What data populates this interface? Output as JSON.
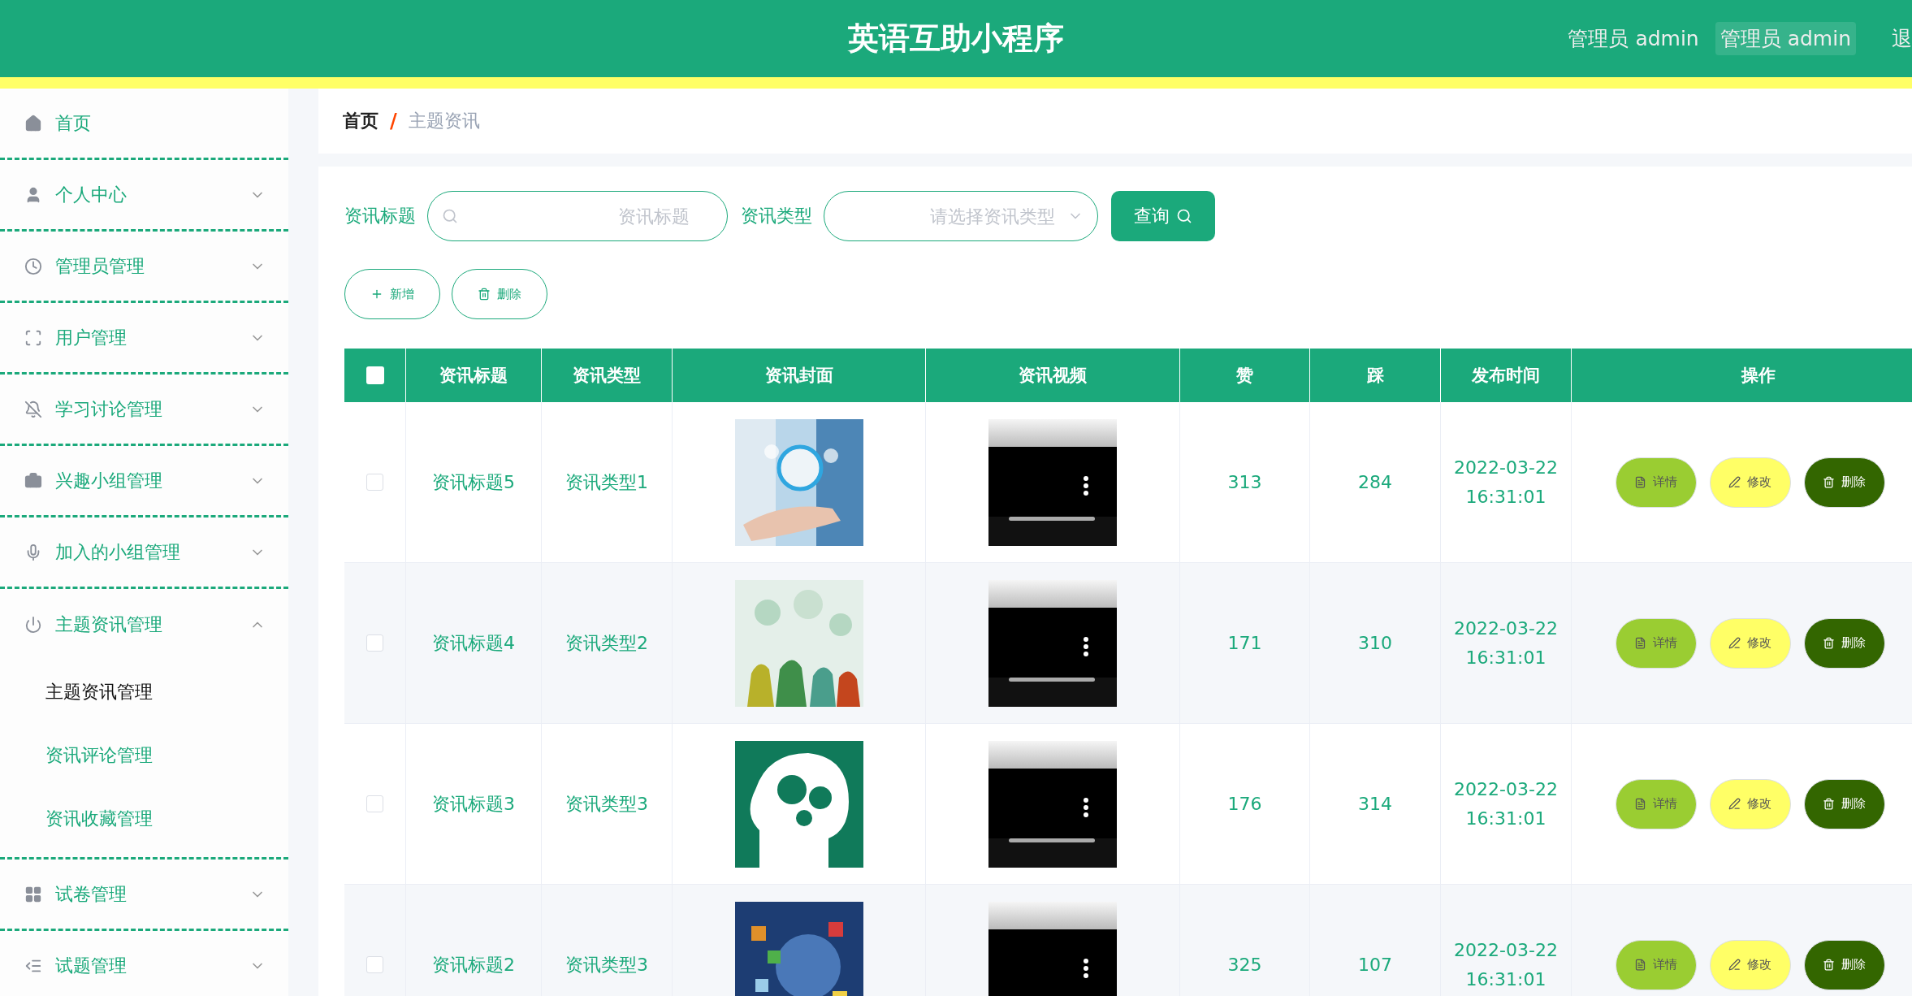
{
  "header": {
    "title": "英语互助小程序",
    "users": [
      {
        "label": "管理员 admin",
        "selected": false
      },
      {
        "label": "管理员 admin",
        "selected": true
      }
    ],
    "logout": "退"
  },
  "sidebar": {
    "items": [
      {
        "label": "首页",
        "kind": "link"
      },
      {
        "label": "个人中心",
        "kind": "menu",
        "expanded": false
      },
      {
        "label": "管理员管理",
        "kind": "menu",
        "expanded": false
      },
      {
        "label": "用户管理",
        "kind": "menu",
        "expanded": false
      },
      {
        "label": "学习讨论管理",
        "kind": "menu",
        "expanded": false
      },
      {
        "label": "兴趣小组管理",
        "kind": "menu",
        "expanded": false
      },
      {
        "label": "加入的小组管理",
        "kind": "menu",
        "expanded": false
      },
      {
        "label": "主题资讯管理",
        "kind": "menu",
        "expanded": true,
        "children": [
          {
            "label": "主题资讯管理",
            "selected": true
          },
          {
            "label": "资讯评论管理",
            "selected": false
          },
          {
            "label": "资讯收藏管理",
            "selected": false
          }
        ]
      },
      {
        "label": "试卷管理",
        "kind": "menu",
        "expanded": false
      },
      {
        "label": "试题管理",
        "kind": "menu",
        "expanded": false
      }
    ]
  },
  "breadcrumb": {
    "items": [
      "首页",
      "主题资讯"
    ],
    "separator": "/"
  },
  "search": {
    "fields": [
      {
        "label": "资讯标题",
        "placeholder": "资讯标题",
        "kind": "input"
      },
      {
        "label": "资讯类型",
        "placeholder": "请选择资讯类型",
        "kind": "select"
      }
    ],
    "button": "查询"
  },
  "actions": [
    {
      "label": "新增",
      "kind": "add"
    },
    {
      "label": "删除",
      "kind": "delete"
    }
  ],
  "table": {
    "select_all": {
      "checked": false
    },
    "columns": [
      "资讯标题",
      "资讯类型",
      "资讯封面",
      "资讯视频",
      "赞",
      "踩",
      "发布时间",
      "操作"
    ],
    "rows": [
      {
        "checked": false,
        "title": "资讯标题5",
        "type": "资讯类型1",
        "likes": "313",
        "dislikes": "284",
        "published": "2022-03-22 16:31:01",
        "actions": [
          {
            "label": "详情",
            "kind": "detail"
          },
          {
            "label": "修改",
            "kind": "edit"
          },
          {
            "label": "删除",
            "kind": "delete"
          }
        ]
      },
      {
        "checked": false,
        "title": "资讯标题4",
        "type": "资讯类型2",
        "likes": "171",
        "dislikes": "310",
        "published": "2022-03-22 16:31:01",
        "actions": [
          {
            "label": "详情",
            "kind": "detail"
          },
          {
            "label": "修改",
            "kind": "edit"
          },
          {
            "label": "删除",
            "kind": "delete"
          }
        ]
      },
      {
        "checked": false,
        "title": "资讯标题3",
        "type": "资讯类型3",
        "likes": "176",
        "dislikes": "314",
        "published": "2022-03-22 16:31:01",
        "actions": [
          {
            "label": "详情",
            "kind": "detail"
          },
          {
            "label": "修改",
            "kind": "edit"
          },
          {
            "label": "删除",
            "kind": "delete"
          }
        ]
      },
      {
        "checked": false,
        "title": "资讯标题2",
        "type": "资讯类型3",
        "likes": "325",
        "dislikes": "107",
        "published": "2022-03-22 16:31:01",
        "actions": [
          {
            "label": "详情",
            "kind": "detail"
          },
          {
            "label": "修改",
            "kind": "edit"
          },
          {
            "label": "删除",
            "kind": "delete"
          }
        ]
      }
    ]
  }
}
